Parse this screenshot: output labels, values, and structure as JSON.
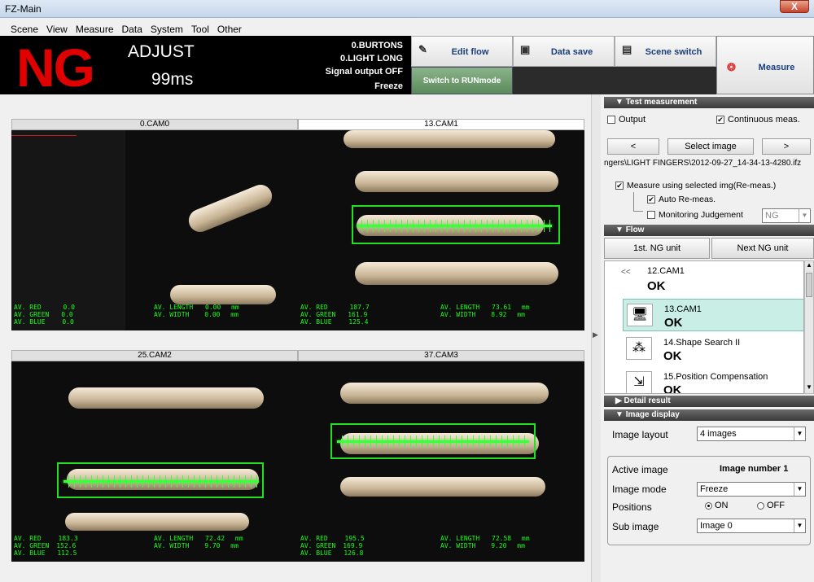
{
  "window": {
    "title": "FZ-Main",
    "close": "X"
  },
  "menu": [
    "Scene",
    "View",
    "Measure",
    "Data",
    "System",
    "Tool",
    "Other"
  ],
  "status": {
    "judgement": "NG",
    "mode": "ADJUST",
    "time": "99ms",
    "info": [
      "0.BURTONS",
      "0.LIGHT LONG",
      "Signal output OFF",
      "Freeze"
    ]
  },
  "toolbar": {
    "edit_flow": "Edit flow",
    "data_save": "Data save",
    "scene_switch": "Scene switch",
    "measure": "Measure",
    "run_mode": "Switch to RUNmode"
  },
  "cameras": [
    {
      "title": "0.CAM0",
      "red": "0.0",
      "green": "0.0",
      "blue": "0.0",
      "length": "0.00",
      "width": "0.00"
    },
    {
      "title": "13.CAM1",
      "red": "187.7",
      "green": "161.9",
      "blue": "125.4",
      "length": "73.61",
      "width": "8.92"
    },
    {
      "title": "25.CAM2",
      "red": "183.3",
      "green": "152.6",
      "blue": "112.5",
      "length": "72.42",
      "width": "9.70"
    },
    {
      "title": "37.CAM3",
      "red": "195.5",
      "green": "169.9",
      "blue": "126.8",
      "length": "72.58",
      "width": "9.20"
    }
  ],
  "overlay_labels": {
    "red": "AV. RED",
    "green": "AV. GREEN",
    "blue": "AV. BLUE",
    "length": "AV. LENGTH",
    "width": "AV. WIDTH",
    "unit": "mm"
  },
  "test": {
    "header": "Test measurement",
    "output": "Output",
    "continuous": "Continuous meas.",
    "prev": "<",
    "select": "Select image",
    "next": ">",
    "path": "ngers\\LIGHT FINGERS\\2012-09-27_14-34-13-4280.ifz",
    "remeas": "Measure using selected img(Re-meas.)",
    "auto": "Auto Re-meas.",
    "monitor": "Monitoring Judgement",
    "monitor_value": "NG"
  },
  "flow": {
    "header": "Flow",
    "first_ng": "1st. NG unit",
    "next_ng": "Next NG unit",
    "back": "<<",
    "items": [
      {
        "name": "12.CAM1",
        "status": "OK"
      },
      {
        "name": "13.CAM1",
        "status": "OK"
      },
      {
        "name": "14.Shape Search II",
        "status": "OK"
      },
      {
        "name": "15.Position Compensation",
        "status": "OK"
      }
    ]
  },
  "detail": {
    "header": "Detail result"
  },
  "display": {
    "header": "Image display",
    "layout_label": "Image layout",
    "layout_value": "4 images",
    "active_label": "Active image",
    "active_value": "Image number 1",
    "mode_label": "Image mode",
    "mode_value": "Freeze",
    "positions_label": "Positions",
    "on": "ON",
    "off": "OFF",
    "sub_label": "Sub image",
    "sub_value": "Image 0"
  }
}
